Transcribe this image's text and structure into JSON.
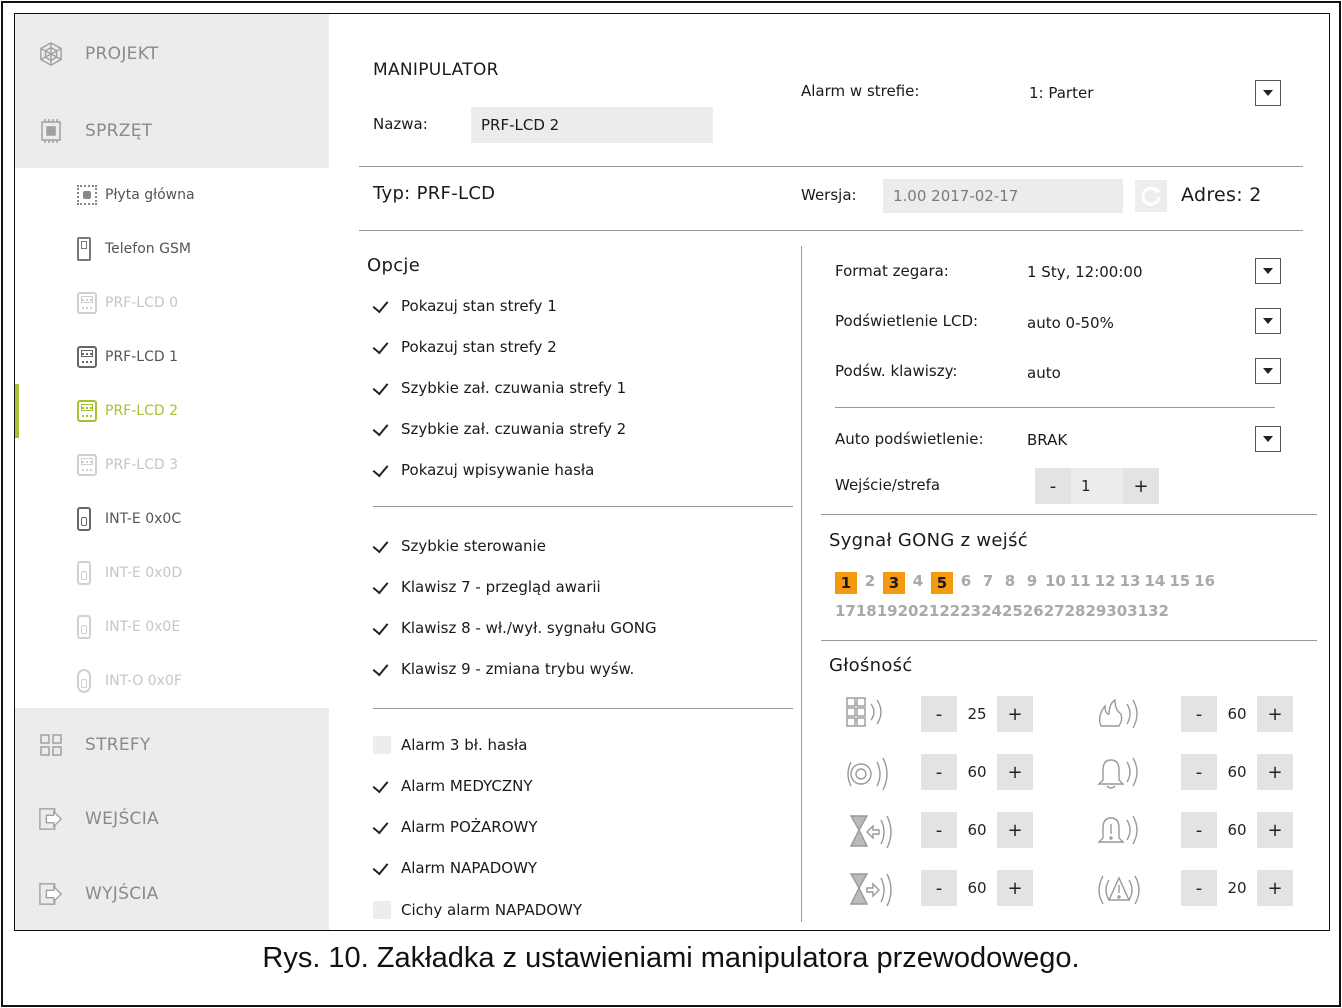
{
  "sidebar": {
    "sections": [
      {
        "label": "PROJEKT",
        "icon": "project-icon"
      },
      {
        "label": "SPRZĘT",
        "icon": "hardware-icon"
      },
      {
        "label": "STREFY",
        "icon": "zones-icon"
      },
      {
        "label": "WEJŚCIA",
        "icon": "inputs-icon"
      },
      {
        "label": "WYJŚCIA",
        "icon": "outputs-icon"
      }
    ],
    "items": [
      {
        "label": "Płyta główna",
        "state": "normal",
        "icon": "mainboard-icon"
      },
      {
        "label": "Telefon GSM",
        "state": "normal",
        "icon": "gsm-phone-icon"
      },
      {
        "label": "PRF-LCD 0",
        "state": "dim",
        "icon": "keypad-icon"
      },
      {
        "label": "PRF-LCD 1",
        "state": "normal",
        "icon": "wireless-keypad-icon"
      },
      {
        "label": "PRF-LCD 2",
        "state": "active",
        "icon": "keypad-icon"
      },
      {
        "label": "PRF-LCD 3",
        "state": "dim",
        "icon": "keypad-icon"
      },
      {
        "label": "INT-E 0x0C",
        "state": "normal",
        "icon": "expander-icon"
      },
      {
        "label": "INT-E 0x0D",
        "state": "dim",
        "icon": "expander-icon"
      },
      {
        "label": "INT-E 0x0E",
        "state": "dim",
        "icon": "expander-icon"
      },
      {
        "label": "INT-O 0x0F",
        "state": "dim",
        "icon": "output-module-icon"
      }
    ]
  },
  "header": {
    "title": "MANIPULATOR",
    "name_label": "Nazwa:",
    "name_value": "PRF-LCD 2",
    "alarm_zone_label": "Alarm w strefie:",
    "alarm_zone_value": "1: Parter"
  },
  "device": {
    "type_label": "Typ:",
    "type_value": "PRF-LCD",
    "version_label": "Wersja:",
    "version_value": "1.00 2017-02-17",
    "address_label": "Adres:",
    "address_value": "2"
  },
  "options": {
    "title": "Opcje",
    "group1": [
      {
        "label": "Pokazuj stan strefy 1",
        "checked": true
      },
      {
        "label": "Pokazuj stan strefy 2",
        "checked": true
      },
      {
        "label": "Szybkie zał. czuwania strefy 1",
        "checked": true
      },
      {
        "label": "Szybkie zał. czuwania strefy 2",
        "checked": true
      },
      {
        "label": "Pokazuj wpisywanie hasła",
        "checked": true
      }
    ],
    "group2": [
      {
        "label": "Szybkie sterowanie",
        "checked": true
      },
      {
        "label": "Klawisz 7 - przegląd awarii",
        "checked": true
      },
      {
        "label": "Klawisz 8 - wł./wył. sygnału GONG",
        "checked": true
      },
      {
        "label": "Klawisz 9  - zmiana trybu wyśw.",
        "checked": true
      }
    ],
    "group3": [
      {
        "label": "Alarm 3 bł. hasła",
        "checked": false
      },
      {
        "label": "Alarm MEDYCZNY",
        "checked": true
      },
      {
        "label": "Alarm POŻAROWY",
        "checked": true
      },
      {
        "label": "Alarm NAPADOWY",
        "checked": true
      },
      {
        "label": "Cichy alarm NAPADOWY",
        "checked": false
      }
    ]
  },
  "settings": {
    "clock_format_label": "Format zegara:",
    "clock_format_value": "1 Sty, 12:00:00",
    "lcd_backlight_label": "Podświetlenie  LCD:",
    "lcd_backlight_value": "auto 0-50%",
    "key_backlight_label": "Podśw. klawiszy:",
    "key_backlight_value": "auto",
    "auto_backlight_label": "Auto podświetlenie:",
    "auto_backlight_value": "BRAK",
    "input_zone_label": "Wejście/strefa",
    "input_zone_value": "1"
  },
  "gong": {
    "title": "Sygnał GONG z wejść",
    "row1": [
      "1",
      "2",
      "3",
      "4",
      "5",
      "6",
      "7",
      "8",
      "9",
      "10",
      "11",
      "12",
      "13",
      "14",
      "15",
      "16"
    ],
    "row2": [
      "17",
      "18",
      "19",
      "20",
      "21",
      "22",
      "23",
      "24",
      "25",
      "26",
      "27",
      "28",
      "29",
      "30",
      "31",
      "32"
    ],
    "active": [
      "1",
      "3",
      "5"
    ]
  },
  "volume": {
    "title": "Głośność",
    "items": [
      {
        "icon": "keypad-sound-icon",
        "value": "25"
      },
      {
        "icon": "fire-sound-icon",
        "value": "60"
      },
      {
        "icon": "siren-sound-icon",
        "value": "60"
      },
      {
        "icon": "bell-sound-icon",
        "value": "60"
      },
      {
        "icon": "entry-delay-sound-icon",
        "value": "60"
      },
      {
        "icon": "bell-warning-sound-icon",
        "value": "60"
      },
      {
        "icon": "exit-delay-sound-icon",
        "value": "60"
      },
      {
        "icon": "alarm-warning-sound-icon",
        "value": "20"
      }
    ],
    "minus": "-",
    "plus": "+"
  },
  "caption": "Rys. 10. Zakładka z ustawieniami manipulatora przewodowego.",
  "colors": {
    "accent": "#a5c232",
    "gong_active": "#f49a10"
  }
}
